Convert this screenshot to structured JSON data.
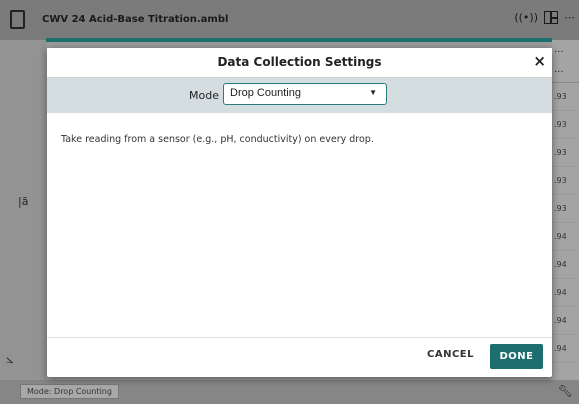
{
  "app": {
    "title": "CWV 24 Acid-Base Titration.ambl",
    "status_mode": "Mode: Drop Counting",
    "right_column": {
      "header": "...",
      "cells": [
        ".93",
        ".93",
        ".93",
        ".93",
        ".93",
        ".94",
        ".94",
        ".94",
        ".94",
        ".94"
      ]
    }
  },
  "dialog": {
    "title": "Data Collection Settings",
    "close_label": "×",
    "mode_label": "Mode",
    "mode_value": "Drop Counting",
    "description": "Take reading from a sensor (e.g., pH, conductivity) on every drop.",
    "cancel_label": "CANCEL",
    "done_label": "DONE"
  },
  "colors": {
    "accent": "#1d6f6f",
    "mode_row_bg": "#d4dde0"
  },
  "icons": [
    "document-icon",
    "wireless-icon",
    "layout-icon",
    "more-icon",
    "graph-axis-icon",
    "chart-icon",
    "wrench-icon"
  ]
}
